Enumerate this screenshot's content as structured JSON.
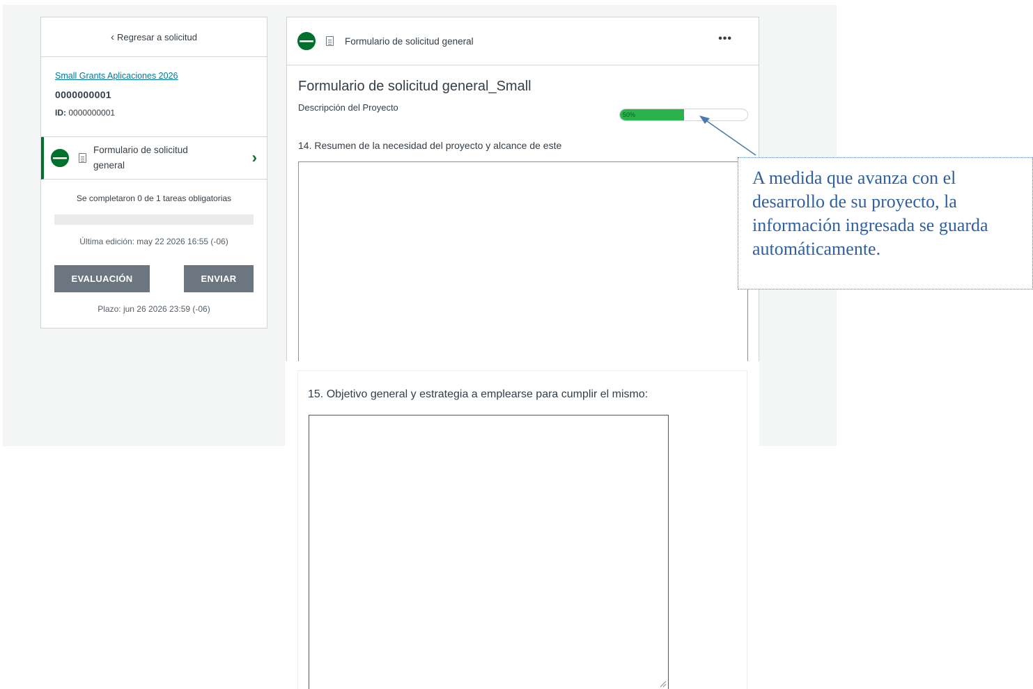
{
  "sidebar": {
    "back_label": "Regresar a solicitud",
    "program_link": "Small Grants Aplicaciones 2026",
    "application_number": "0000000001",
    "id_label": "ID:",
    "id_value": "0000000001",
    "task_label": "Formulario de solicitud general",
    "tasks_status": "Se completaron 0 de 1 tareas obligatorias",
    "required_progress": 0,
    "last_edit": "Última edición: may 22 2026 16:55 (-06)",
    "evaluation_button": "EVALUACIÓN",
    "send_button": "ENVIAR",
    "deadline": "Plazo: jun 26 2026 23:59 (-06)"
  },
  "main": {
    "header_title": "Formulario de solicitud general",
    "more_label": "•••",
    "form_title": "Formulario de solicitud general_Small",
    "section_label": "Descripción del Proyecto",
    "progress_label": "50%",
    "progress_value": 0.5,
    "question_14": "14. Resumen de la necesidad del proyecto y alcance de este",
    "question_15": "15. Objetivo general y estrategia a emplearse para cumplir el mismo:"
  },
  "callout": {
    "text": "A medida que avanza con el desarrollo de su proyecto, la información ingresada se guarda automáticamente."
  },
  "colors": {
    "accent_green": "#00702d",
    "progress_green": "#2bb24c",
    "link_blue": "#00789f",
    "callout_blue": "#2e5fa1",
    "button_gray": "#6b7680"
  },
  "icons": [
    "chevron-left-icon",
    "status-half-circle-icon",
    "document-icon",
    "chevron-right-icon",
    "more-dots-icon",
    "resize-grip-icon"
  ]
}
